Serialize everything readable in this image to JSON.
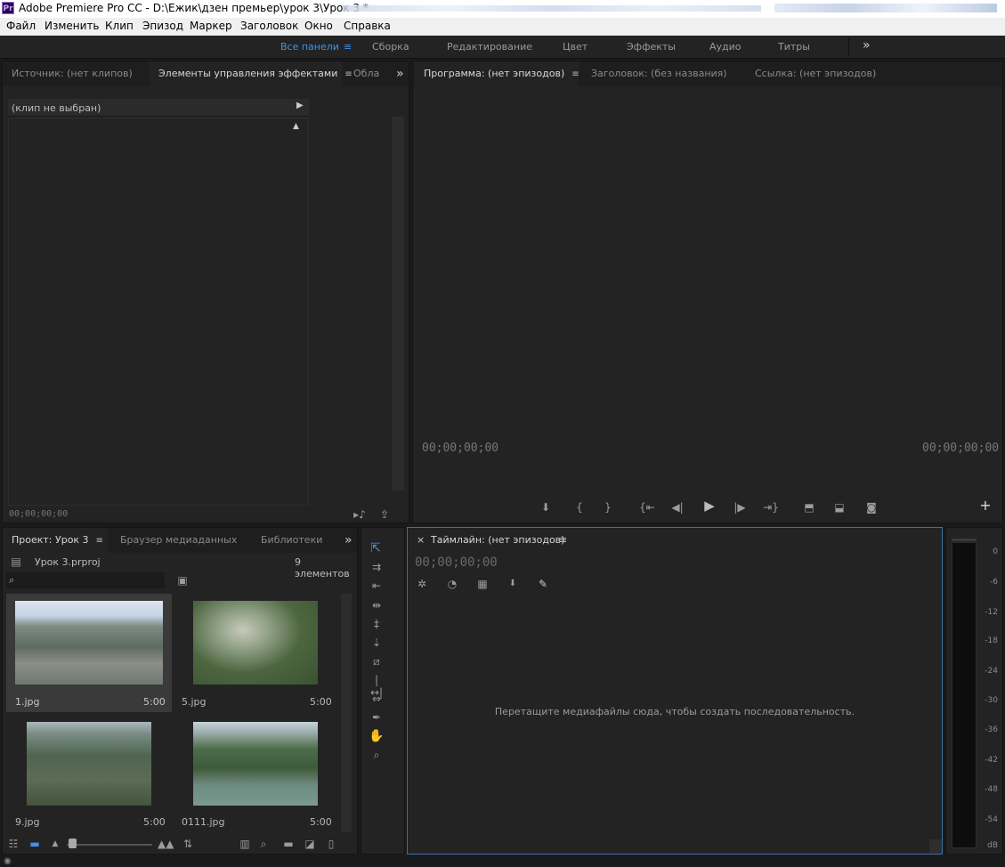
{
  "window": {
    "app_icon": "Pr",
    "title": "Adobe Premiere Pro CC - D:\\Ежик\\дзен  премьер\\урок 3\\Урок 3 *"
  },
  "menu": [
    "Файл",
    "Изменить",
    "Клип",
    "Эпизод",
    "Маркер",
    "Заголовок",
    "Окно",
    "Справка"
  ],
  "workspaces": [
    "Все панели",
    "Сборка",
    "Редактирование",
    "Цвет",
    "Эффекты",
    "Аудио",
    "Титры"
  ],
  "workspace_more": "»",
  "source_panel": {
    "tabs": [
      "Источник: (нет клипов)",
      "Элементы управления эффектами",
      "Обла"
    ],
    "clip_label": "(клип не выбран)",
    "timecode": "00;00;00;00"
  },
  "program_panel": {
    "tabs": [
      "Программа: (нет эпизодов)",
      "Заголовок: (без названия)",
      "Ссылка: (нет эпизодов)"
    ],
    "timecode_left": "00;00;00;00",
    "timecode_right": "00;00;00;00",
    "add": "+"
  },
  "project_panel": {
    "tabs": [
      "Проект: Урок 3",
      "Браузер медиаданных",
      "Библиотеки"
    ],
    "filename": "Урок 3.prproj",
    "count": "9 элементов",
    "items": [
      {
        "name": "1.jpg",
        "duration": "5:00"
      },
      {
        "name": "5.jpg",
        "duration": "5:00"
      },
      {
        "name": "9.jpg",
        "duration": "5:00"
      },
      {
        "name": "0111.jpg",
        "duration": "5:00"
      }
    ]
  },
  "timeline_panel": {
    "close": "×",
    "title": "Таймлайн: (нет эпизодов)",
    "timecode": "00;00;00;00",
    "placeholder": "Перетащите медиафайлы сюда, чтобы создать последовательность."
  },
  "audio_meter": {
    "ticks": [
      "0",
      "-6",
      "-12",
      "-18",
      "-24",
      "-30",
      "-36",
      "-42",
      "-48",
      "-54",
      "dB"
    ]
  },
  "icons": {
    "search": "search-icon",
    "more": "chevron-double-right-icon",
    "menu": "hamburger-icon"
  },
  "colors": {
    "accent": "#3d94e8",
    "panel_bg": "#232323",
    "timeline_border": "#3a6fa8"
  }
}
